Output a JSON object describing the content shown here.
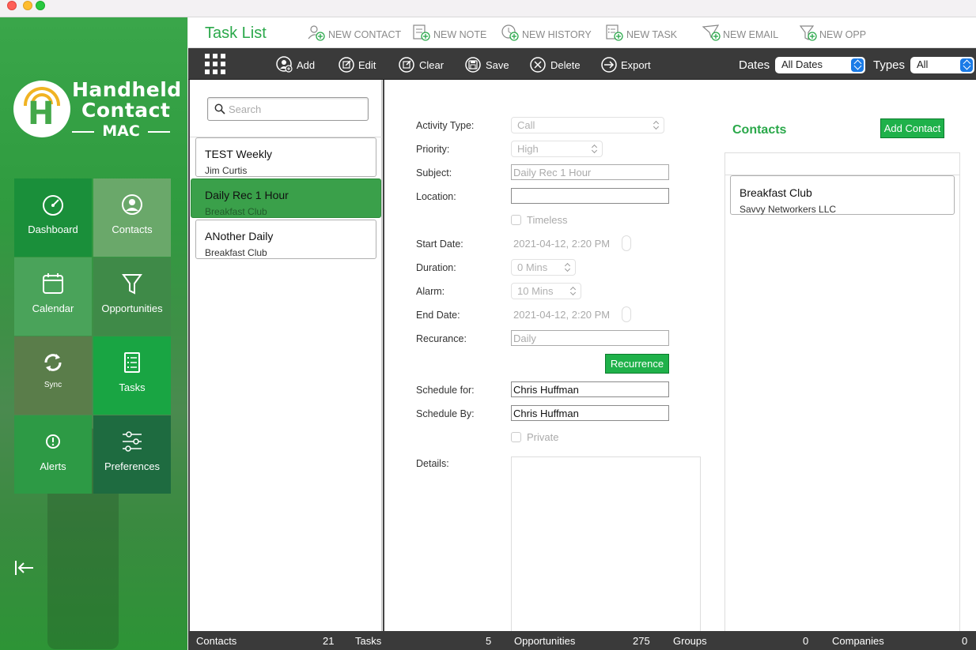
{
  "app": {
    "logo_line1": "Handheld",
    "logo_line2": "Contact",
    "logo_line3": "MAC"
  },
  "sidebar": {
    "tiles": [
      {
        "label": "Dashboard",
        "icon": "gauge-icon",
        "color": "#1a8f3a"
      },
      {
        "label": "Contacts",
        "icon": "person-circle-icon",
        "color": "#6aa86a"
      },
      {
        "label": "Calendar",
        "icon": "calendar-icon",
        "color": "#4aa35a"
      },
      {
        "label": "Opportunities",
        "icon": "funnel-icon",
        "color": "#3f8a48"
      },
      {
        "label": "Sync",
        "icon": "sync-icon",
        "color": "#5a7d4a"
      },
      {
        "label": "Tasks",
        "icon": "checklist-icon",
        "color": "#19a543"
      },
      {
        "label": "Alerts",
        "icon": "alert-icon",
        "color": "#2d9a45"
      },
      {
        "label": "Preferences",
        "icon": "sliders-icon",
        "color": "#1e6b40"
      }
    ]
  },
  "header": {
    "title": "Task List",
    "actions": [
      "NEW CONTACT",
      "NEW NOTE",
      "NEW HISTORY",
      "NEW TASK",
      "NEW EMAIL",
      "NEW OPP"
    ]
  },
  "toolbar": {
    "buttons": [
      "Add",
      "Edit",
      "Clear",
      "Save",
      "Delete",
      "Export"
    ],
    "dates_label": "Dates",
    "dates_value": "All Dates",
    "types_label": "Types",
    "types_value": "All"
  },
  "list": {
    "search_placeholder": "Search",
    "items": [
      {
        "title": "TEST Weekly",
        "subtitle": "Jim Curtis"
      },
      {
        "title": "Daily Rec 1 Hour",
        "subtitle": "Breakfast Club"
      },
      {
        "title": "ANother Daily",
        "subtitle": "Breakfast Club"
      }
    ]
  },
  "form": {
    "activity_type_label": "Activity Type:",
    "activity_type_value": "Call",
    "priority_label": "Priority:",
    "priority_value": "High",
    "subject_label": "Subject:",
    "subject_value": "Daily Rec 1 Hour",
    "location_label": "Location:",
    "location_value": "",
    "timeless_label": "Timeless",
    "start_date_label": "Start Date:",
    "start_date_value": "2021-04-12,   2:20 PM",
    "duration_label": "Duration:",
    "duration_value": "0 Mins",
    "alarm_label": "Alarm:",
    "alarm_value": "10 Mins",
    "end_date_label": "End Date:",
    "end_date_value": "2021-04-12,   2:20 PM",
    "recurance_label": "Recurance:",
    "recurance_value": "Daily",
    "recurrence_button": "Recurrence",
    "schedule_for_label": "Schedule for:",
    "schedule_for_value": "Chris Huffman",
    "schedule_by_label": "Schedule By:",
    "schedule_by_value": "Chris Huffman",
    "private_label": "Private",
    "details_label": "Details:",
    "details_value": ""
  },
  "contacts": {
    "heading": "Contacts",
    "add_button": "Add Contact",
    "items": [
      {
        "name": "Breakfast Club",
        "company": "Savvy Networkers LLC"
      }
    ]
  },
  "status": {
    "contacts_label": "Contacts",
    "contacts_count": "21",
    "tasks_label": "Tasks",
    "tasks_count": "5",
    "opps_label": "Opportunities",
    "opps_count": "275",
    "groups_label": "Groups",
    "groups_count": "0",
    "companies_label": "Companies",
    "companies_count": "0"
  },
  "colors": {
    "accent_green": "#2aa84a",
    "selected_row": "#3aa04a",
    "toolbar_dark": "#3a3a3a"
  }
}
